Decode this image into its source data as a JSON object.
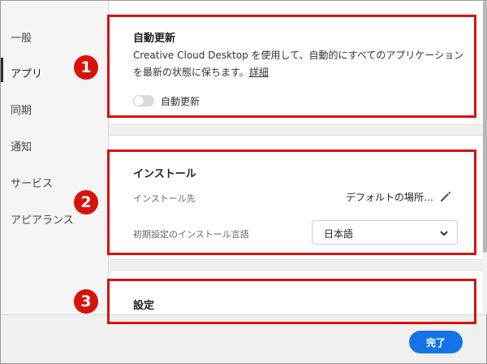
{
  "sidebar": {
    "items": [
      {
        "label": "一般"
      },
      {
        "label": "アプリ"
      },
      {
        "label": "同期"
      },
      {
        "label": "通知"
      },
      {
        "label": "サービス"
      },
      {
        "label": "アピアランス"
      }
    ],
    "active": "アプリ"
  },
  "auto_update": {
    "title": "自動更新",
    "description": "Creative Cloud Desktop を使用して、自動的にすべてのアプリケーションを最新の状態に保ちます。",
    "link": "詳細",
    "toggle_label": "自動更新",
    "toggle_on": false
  },
  "install": {
    "title": "インストール",
    "location_label": "インストール先",
    "location_value": "デフォルトの場所…",
    "language_label": "初期設定のインストール言語",
    "language_value": "日本語"
  },
  "settings": {
    "title": "設定"
  },
  "footer": {
    "done_label": "完了"
  },
  "callouts": {
    "badge_1": "1",
    "badge_2": "2",
    "badge_3": "3",
    "color": "#d7120c"
  },
  "colors": {
    "accent": "#1473e6"
  }
}
